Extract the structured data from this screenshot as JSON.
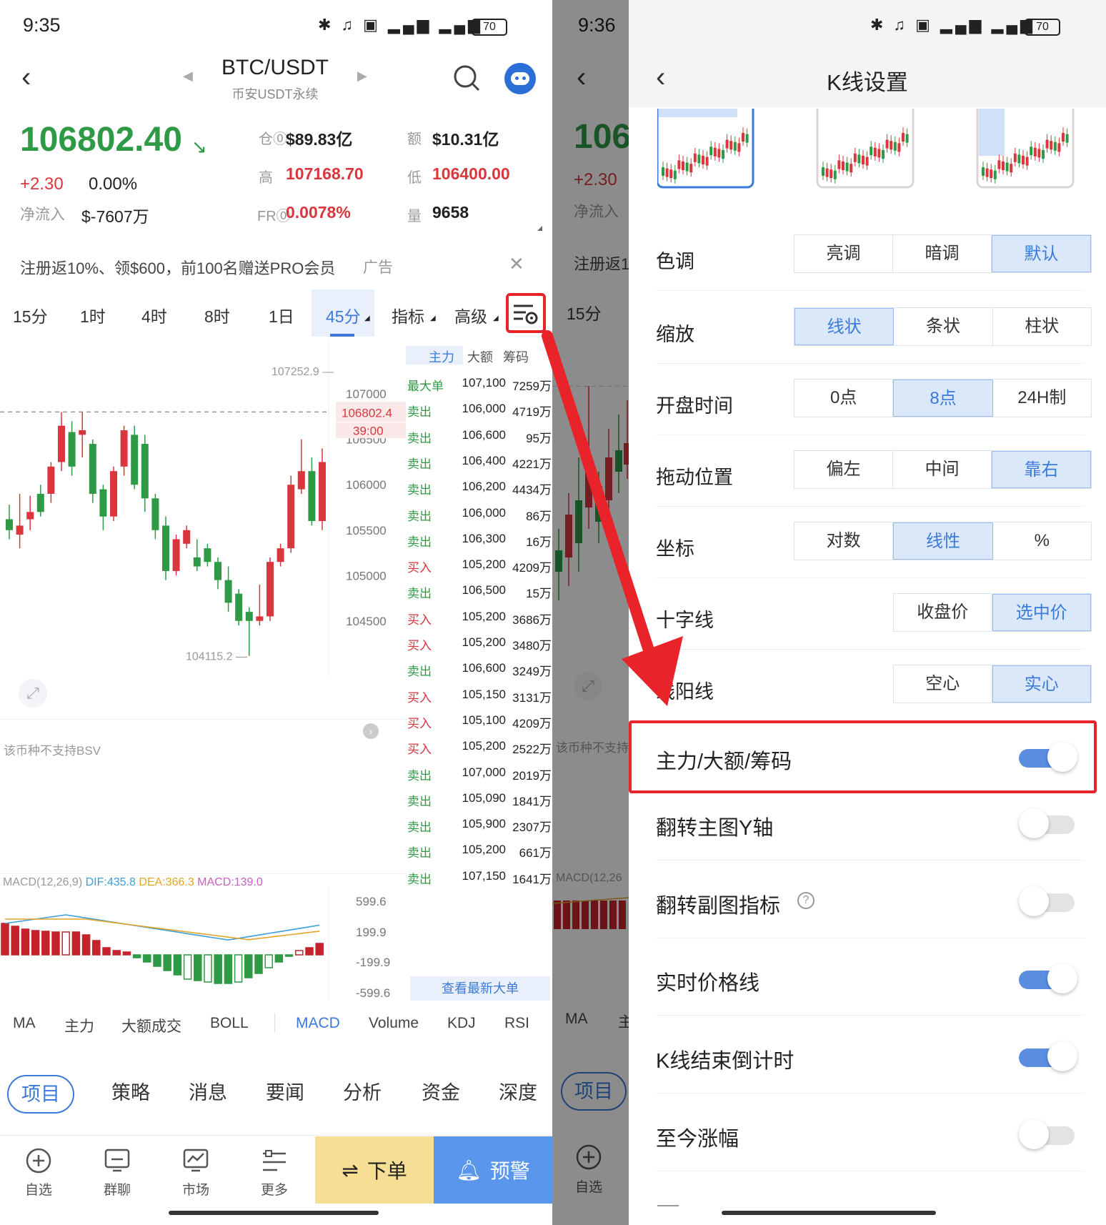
{
  "left": {
    "status": {
      "time": "9:35",
      "battery": "70"
    },
    "header": {
      "pair": "BTC/USDT",
      "subtitle": "币安USDT永续"
    },
    "price": {
      "last": "106802.40",
      "arrow": "↘",
      "change": "+2.30",
      "change_pct": "0.00%",
      "netflow_label": "净流入",
      "netflow": "$-7607万",
      "oi_label": "仓⓪",
      "oi": "$89.83亿",
      "vol_amt_label": "额",
      "vol_amt": "$10.31亿",
      "high_label": "高",
      "high": "107168.70",
      "low_label": "低",
      "low": "106400.00",
      "fr_label": "FR⓪",
      "fr": "0.0078%",
      "qty_label": "量",
      "qty": "9658"
    },
    "banner": {
      "text": "注册返10%、领$600，前100名赠送PRO会员",
      "ad": "广告",
      "close": "✕"
    },
    "timeframes": [
      {
        "label": "15分"
      },
      {
        "label": "1时"
      },
      {
        "label": "4时"
      },
      {
        "label": "8时"
      },
      {
        "label": "1日"
      },
      {
        "label": "45分"
      },
      {
        "label": "指标"
      },
      {
        "label": "高级"
      }
    ],
    "orderbook_tabs": [
      "主力",
      "大额",
      "筹码"
    ],
    "orderbook": [
      {
        "side": "最大单",
        "price": "107,100",
        "amount": "7259万"
      },
      {
        "side": "卖出",
        "price": "106,000",
        "amount": "4719万"
      },
      {
        "side": "卖出",
        "price": "106,600",
        "amount": "95万"
      },
      {
        "side": "卖出",
        "price": "106,400",
        "amount": "4221万"
      },
      {
        "side": "卖出",
        "price": "106,200",
        "amount": "4434万"
      },
      {
        "side": "卖出",
        "price": "106,000",
        "amount": "86万"
      },
      {
        "side": "卖出",
        "price": "106,300",
        "amount": "16万"
      },
      {
        "side": "买入",
        "price": "105,200",
        "amount": "4209万"
      },
      {
        "side": "卖出",
        "price": "106,500",
        "amount": "15万"
      },
      {
        "side": "买入",
        "price": "105,200",
        "amount": "3686万"
      },
      {
        "side": "买入",
        "price": "105,200",
        "amount": "3480万"
      },
      {
        "side": "卖出",
        "price": "106,600",
        "amount": "3249万"
      },
      {
        "side": "买入",
        "price": "105,150",
        "amount": "3131万"
      },
      {
        "side": "买入",
        "price": "105,100",
        "amount": "4209万"
      },
      {
        "side": "买入",
        "price": "105,200",
        "amount": "2522万"
      },
      {
        "side": "卖出",
        "price": "107,000",
        "amount": "2019万"
      },
      {
        "side": "卖出",
        "price": "105,090",
        "amount": "1841万"
      },
      {
        "side": "卖出",
        "price": "105,900",
        "amount": "2307万"
      },
      {
        "side": "卖出",
        "price": "105,200",
        "amount": "661万"
      },
      {
        "side": "卖出",
        "price": "107,150",
        "amount": "1641万"
      }
    ],
    "orderbook_more": "查看最新大单",
    "chart": {
      "high_mark": "107252.9",
      "low_mark": "104115.2",
      "current": "106802.4",
      "countdown": "39:00",
      "yticks": [
        "107000",
        "106500",
        "106000",
        "105500",
        "105000",
        "104500"
      ],
      "bsv_note": "该币种不支持BSV",
      "macd_title": "MACD(12,26,9)",
      "dif": "DIF:435.8",
      "dea": "DEA:366.3",
      "macd": "MACD:139.0",
      "macd_ticks": [
        "599.6",
        "199.9",
        "-199.9",
        "-599.6"
      ]
    },
    "indicators": [
      "MA",
      "主力",
      "大额成交",
      "BOLL",
      "MACD",
      "Volume",
      "KDJ",
      "RSI"
    ],
    "content_tabs": [
      "项目",
      "策略",
      "消息",
      "要闻",
      "分析",
      "资金",
      "深度"
    ],
    "bottom_nav": [
      {
        "label": "自选"
      },
      {
        "label": "群聊"
      },
      {
        "label": "市场"
      },
      {
        "label": "更多"
      }
    ],
    "order_button": "下单",
    "alert_button": "预警"
  },
  "mid": {
    "time": "9:36",
    "price": "106",
    "change": "+2.30",
    "netflow": "净流入",
    "banner": "注册返1",
    "tf": "15分",
    "note": "该币种不支持",
    "macd": "MACD(12,26",
    "ind": "MA",
    "ind2": "主",
    "tab": "项目",
    "nav": "自选"
  },
  "right": {
    "status": {
      "battery": "70"
    },
    "title": "K线设置",
    "rows": [
      {
        "label": "色调",
        "options": [
          "亮调",
          "暗调",
          "默认"
        ],
        "selected": 2
      },
      {
        "label": "缩放",
        "options": [
          "线状",
          "条状",
          "柱状"
        ],
        "selected": 0
      },
      {
        "label": "开盘时间",
        "options": [
          "0点",
          "8点",
          "24H制"
        ],
        "selected": 1
      },
      {
        "label": "拖动位置",
        "options": [
          "偏左",
          "中间",
          "靠右"
        ],
        "selected": 2
      },
      {
        "label": "坐标",
        "options": [
          "对数",
          "线性",
          "%"
        ],
        "selected": 1
      },
      {
        "label": "十字线",
        "options": [
          "收盘价",
          "选中价"
        ],
        "selected": 1
      },
      {
        "label": "线阳线",
        "options": [
          "空心",
          "实心"
        ],
        "selected": 1
      }
    ],
    "toggles": [
      {
        "label": "主力/大额/筹码",
        "on": true
      },
      {
        "label": "翻转主图Y轴",
        "on": false
      },
      {
        "label": "翻转副图指标",
        "on": false
      },
      {
        "label": "实时价格线",
        "on": true
      },
      {
        "label": "K线结束倒计时",
        "on": true
      },
      {
        "label": "至今涨幅",
        "on": false
      }
    ],
    "help_icon": "?"
  },
  "colors": {
    "up": "#d9363e",
    "down": "#2f9a45",
    "accent": "#3b7ad9",
    "highlight": "#e8232a"
  }
}
